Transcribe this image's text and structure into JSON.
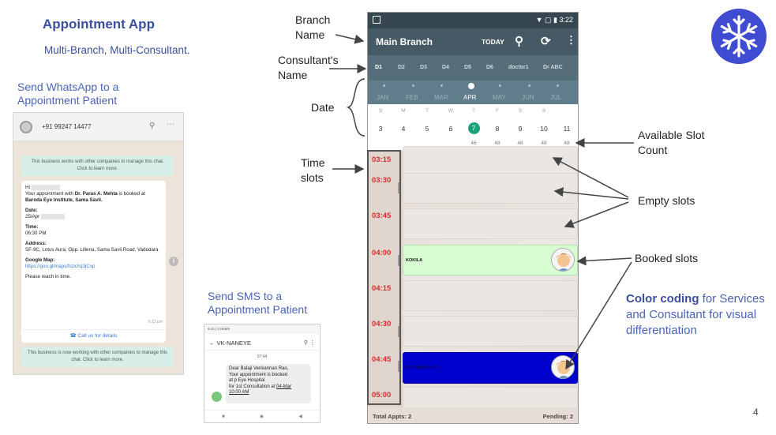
{
  "header": {
    "title": "Appointment App",
    "subtitle": "Multi-Branch, Multi-Consultant."
  },
  "whatsapp_section": {
    "heading_line1": "Send WhatsApp to a",
    "heading_line2": "Appointment Patient",
    "phone_number": "+91 99247 14477",
    "notice_top": "This business works with other companies to manage this chat. Click to learn more.",
    "greeting": "Hi",
    "line1_pre": "Your appointment with ",
    "doctor": "Dr. Paras A. Mehta",
    "line1_mid": " is booked at ",
    "institute": "Baroda Eye Institute, Sama Savli.",
    "date_label": "Date:",
    "date_value": "25/Apr",
    "time_label": "Time:",
    "time_value": "06:30 PM",
    "address_label": "Address:",
    "address_value": "SF-9C, Lotus Aura, Opp. Lilleria, Sama Savli Road, Vadodara",
    "map_label": "Google Map:",
    "map_link": "https://goo.gl/maps/fszxXq3jCxp",
    "closing": "Please reach in time.",
    "msg_time": "6:12 pm",
    "call_label": "Call us for details",
    "notice_bottom": "This business is now working with other companies to manage this chat. Click to learn more."
  },
  "sms_section": {
    "heading_line1": "Send SMS to a",
    "heading_line2": "Appointment Patient",
    "status_text": "9:41 | 0.0KB/s",
    "sender": "VK-NANEYE",
    "date": "07:44",
    "body_line1": "Dear Balaji Venkannan Rao,",
    "body_line2": "Your appointment is booked",
    "body_line3": "at          p Eye Hospital",
    "body_line4_pre": "for 1st Consultation at ",
    "body_line4_link": "04-Mar",
    "body_line5": "10:00 AM"
  },
  "phone": {
    "status_time": "3:22",
    "branch": "Main Branch",
    "today": "TODAY",
    "consultants": [
      "D1",
      "D2",
      "D3",
      "D4",
      "D5",
      "D6",
      "doctor1",
      "Dr ABC"
    ],
    "months": [
      "JAN",
      "FEB",
      "MAR",
      "APR",
      "MAY",
      "JUN",
      "JUL"
    ],
    "weekdays": [
      "S",
      "M",
      "T",
      "W",
      "T",
      "F",
      "S",
      "S"
    ],
    "days": [
      "3",
      "4",
      "5",
      "6",
      "7",
      "8",
      "9",
      "10",
      "11"
    ],
    "slot_counts": [
      "46",
      "48",
      "48",
      "48",
      "48"
    ],
    "times": [
      "03:15",
      "03:30",
      "03:45",
      "04:00",
      "04:15",
      "04:30",
      "04:45",
      "05:00"
    ],
    "booked_name_1": "KOKILA",
    "booked_name_2": "MANISHA SHAH",
    "total_appts": "Total Appts: 2",
    "pending": "Pending: 2"
  },
  "callouts": {
    "branch_name_1": "Branch",
    "branch_name_2": "Name",
    "consultant_1": "Consultant's",
    "consultant_2": "Name",
    "date": "Date",
    "time_1": "Time",
    "time_2": "slots",
    "slot_count_1": "Available Slot",
    "slot_count_2": "Count",
    "empty": "Empty slots",
    "booked": "Booked slots",
    "color_bold": "Color coding",
    "color_rest": " for Services and Consultant for visual differentiation"
  },
  "page_number": "4",
  "colors": {
    "brand": "#3a4fa0",
    "app_bar": "#455a64",
    "booked_green": "#d8fdd2",
    "booked_blue": "#0000cc",
    "time_red": "#d32f2f"
  }
}
